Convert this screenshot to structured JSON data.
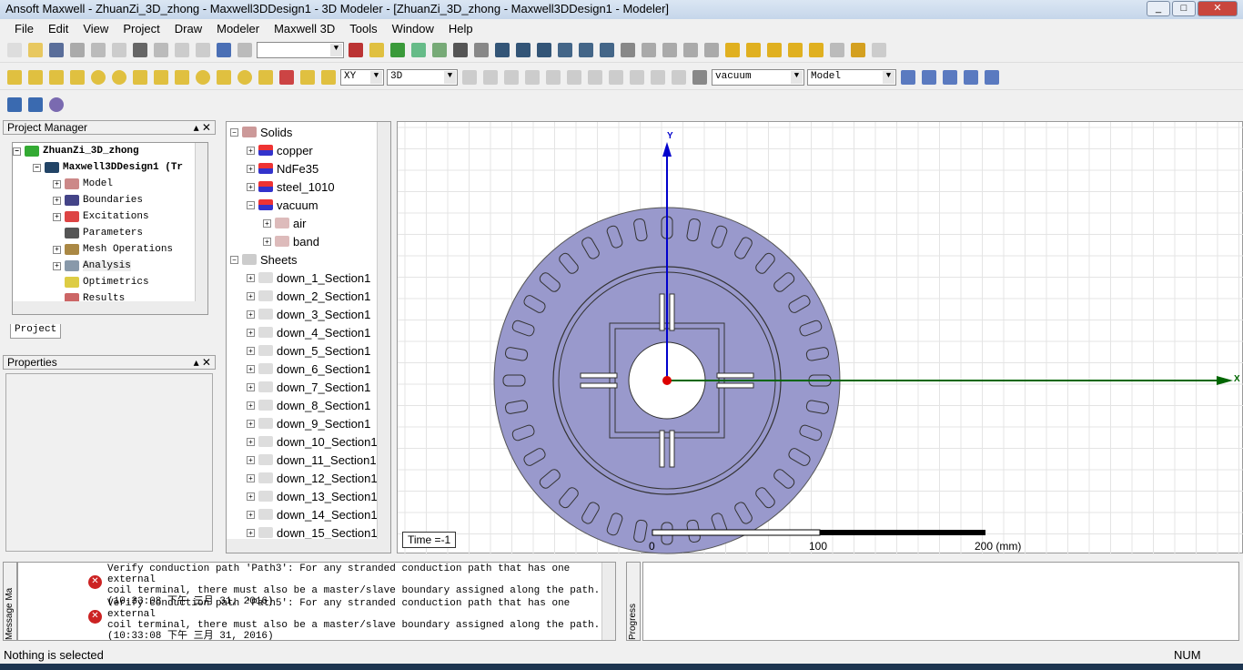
{
  "window": {
    "title": "Ansoft Maxwell  - ZhuanZi_3D_zhong - Maxwell3DDesign1 - 3D Modeler - [ZhuanZi_3D_zhong - Maxwell3DDesign1 - Modeler]"
  },
  "menu": [
    "File",
    "Edit",
    "View",
    "Project",
    "Draw",
    "Modeler",
    "Maxwell 3D",
    "Tools",
    "Window",
    "Help"
  ],
  "toolbar": {
    "plane": "XY",
    "mode": "3D",
    "material": "vacuum",
    "model": "Model"
  },
  "project_manager": {
    "title": "Project Manager",
    "tab": "Project",
    "project": "ZhuanZi_3D_zhong",
    "design": "Maxwell3DDesign1 (Tr",
    "items": [
      "Model",
      "Boundaries",
      "Excitations",
      "Parameters",
      "Mesh Operations",
      "Analysis",
      "Optimetrics",
      "Results"
    ]
  },
  "properties": {
    "title": "Properties"
  },
  "model_tree": {
    "solids": "Solids",
    "materials": [
      "copper",
      "NdFe35",
      "steel_1010",
      "vacuum"
    ],
    "vacuum_children": [
      "air",
      "band"
    ],
    "sheets": "Sheets",
    "sheet_items": [
      "down_1_Section1",
      "down_2_Section1",
      "down_3_Section1",
      "down_4_Section1",
      "down_5_Section1",
      "down_6_Section1",
      "down_7_Section1",
      "down_8_Section1",
      "down_9_Section1",
      "down_10_Section1",
      "down_11_Section1",
      "down_12_Section1",
      "down_13_Section1",
      "down_14_Section1",
      "down_15_Section1"
    ]
  },
  "viewport": {
    "time_label": "Time =-1",
    "axis_x": "X",
    "axis_y": "Y",
    "scale": [
      "0",
      "100",
      "200 (mm)"
    ],
    "model_color": "#9999cc"
  },
  "messages": {
    "tab": "Message Ma",
    "items": [
      {
        "line1": "Verify conduction path 'Path3': For any stranded conduction path that has one external",
        "line2": "coil terminal, there must also be a master/slave boundary assigned along the path.",
        "line3": "(10:33:08 下午  三月 31, 2016)"
      },
      {
        "line1": "Verify conduction path 'Path5': For any stranded conduction path that has one external",
        "line2": "coil terminal, there must also be a master/slave boundary assigned along the path.",
        "line3": "(10:33:08 下午  三月 31, 2016)"
      }
    ]
  },
  "progress": {
    "tab": "Progress"
  },
  "status": {
    "text": "Nothing is selected",
    "num": "NUM"
  }
}
